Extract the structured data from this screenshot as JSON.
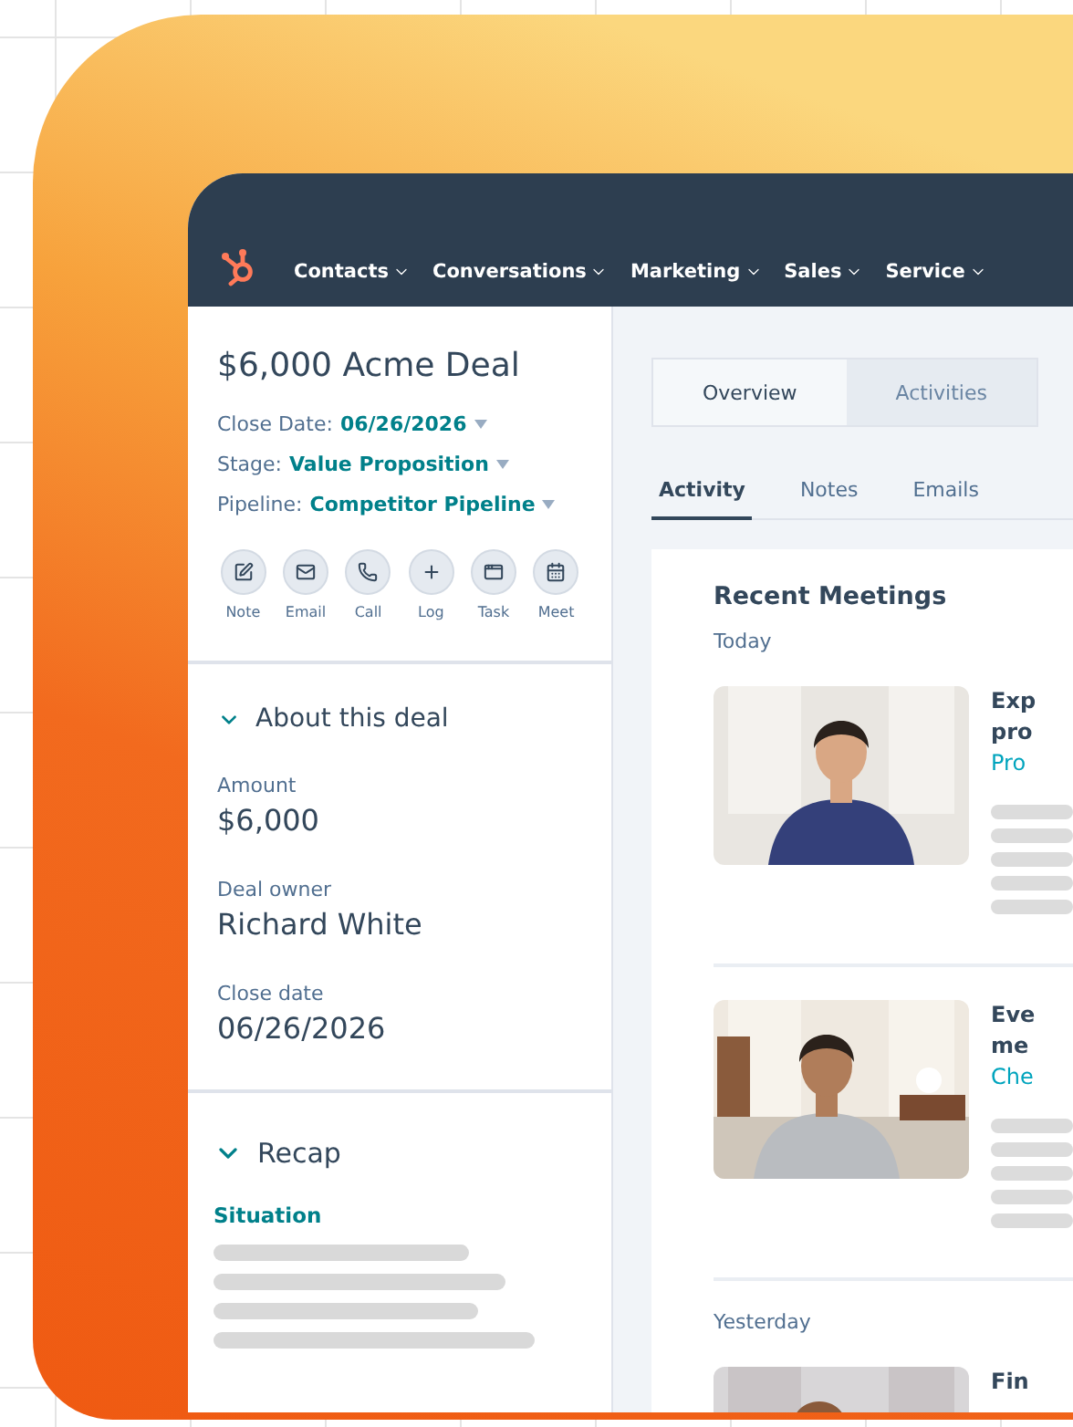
{
  "nav": {
    "items": [
      {
        "label": "Contacts"
      },
      {
        "label": "Conversations"
      },
      {
        "label": "Marketing"
      },
      {
        "label": "Sales"
      },
      {
        "label": "Service"
      }
    ]
  },
  "deal": {
    "title": "$6,000 Acme Deal",
    "fields": [
      {
        "label": "Close Date:",
        "value": "06/26/2026"
      },
      {
        "label": "Stage:",
        "value": "Value Proposition"
      },
      {
        "label": "Pipeline:",
        "value": "Competitor Pipeline"
      }
    ],
    "actions": [
      {
        "kind": "note",
        "label": "Note"
      },
      {
        "kind": "email",
        "label": "Email"
      },
      {
        "kind": "call",
        "label": "Call"
      },
      {
        "kind": "log",
        "label": "Log"
      },
      {
        "kind": "task",
        "label": "Task"
      },
      {
        "kind": "meet",
        "label": "Meet"
      }
    ]
  },
  "about": {
    "title": "About this deal",
    "expanded": true,
    "properties": [
      {
        "label": "Amount",
        "value": "$6,000"
      },
      {
        "label": "Deal owner",
        "value": "Richard White"
      },
      {
        "label": "Close date",
        "value": "06/26/2026"
      }
    ]
  },
  "recap": {
    "title": "Recap",
    "expanded": true,
    "subtitle": "Situation"
  },
  "view_tabs": [
    {
      "label": "Overview",
      "selected": true
    },
    {
      "label": "Activities",
      "selected": false
    }
  ],
  "activity_tabs": [
    {
      "label": "Activity",
      "selected": true
    },
    {
      "label": "Notes",
      "selected": false
    },
    {
      "label": "Emails",
      "selected": false
    }
  ],
  "meetings": {
    "title": "Recent Meetings",
    "groups": [
      {
        "label": "Today",
        "items": [
          {
            "kind": "picture",
            "title_lines": [
              "Exp",
              "pro"
            ],
            "link": "Pro"
          },
          {
            "kind": "picture",
            "title_lines": [
              "Eve",
              "me"
            ],
            "link": "Che"
          }
        ]
      },
      {
        "label": "Yesterday",
        "items": [
          {
            "kind": "picture",
            "title_lines": [
              "Fin"
            ]
          }
        ]
      }
    ]
  }
}
